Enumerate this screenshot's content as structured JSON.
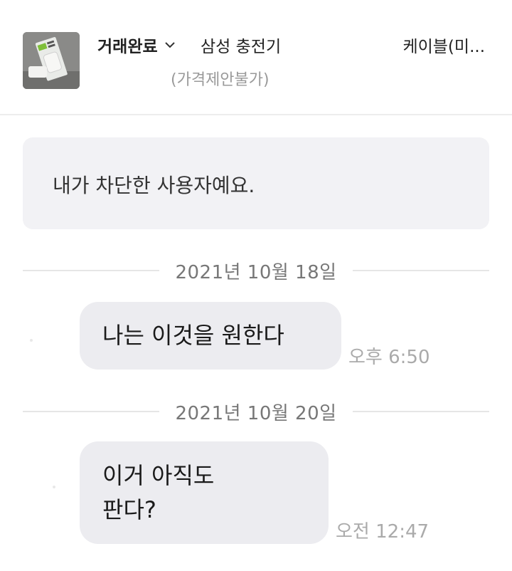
{
  "header": {
    "status": "거래완료",
    "product_title_left": "삼성 충전기",
    "product_title_right": "케이블(미...",
    "price_note": "(가격제안불가)",
    "thumbnail_icon": "charger-box-photo",
    "dropdown_icon": "chevron-down-icon"
  },
  "notice": {
    "blocked_text": "내가 차단한 사용자예요."
  },
  "messages": [
    {
      "date": "2021년 10월 18일",
      "lines": [
        "나는 이것을 원한다"
      ],
      "time": "오후 6:50"
    },
    {
      "date": "2021년 10월 20일",
      "lines": [
        "이거 아직도",
        "판다?"
      ],
      "time": "오전 12:47"
    }
  ],
  "colors": {
    "bubble": "#ececf0",
    "banner": "#f2f2f5",
    "time": "#aaaaaa",
    "date": "#777777"
  }
}
